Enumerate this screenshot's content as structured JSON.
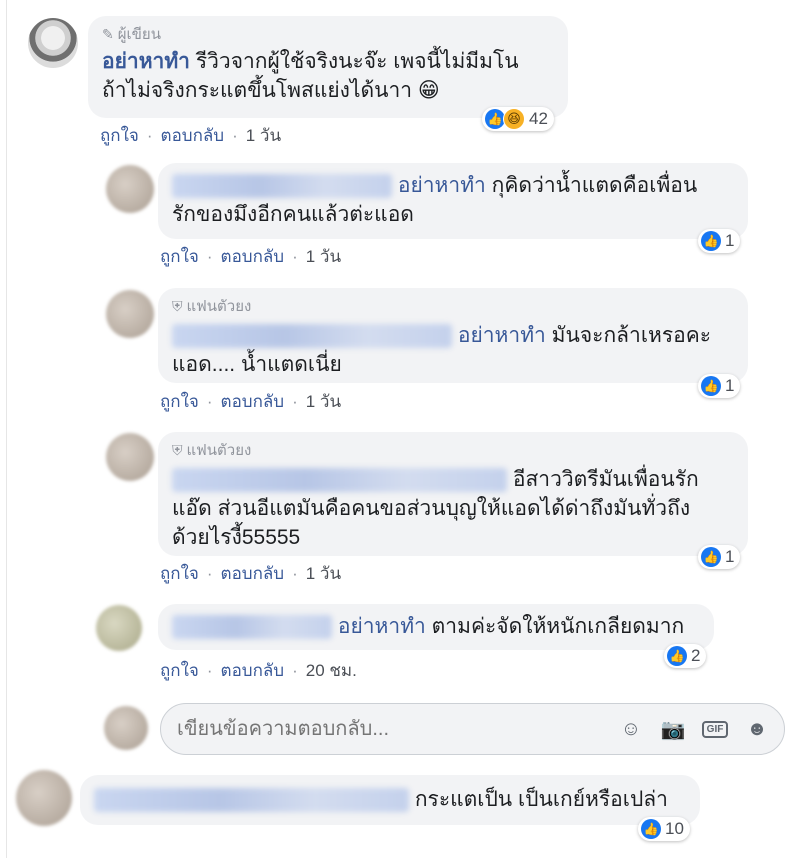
{
  "comments": [
    {
      "badge": "ผู้เขียน",
      "author": "อย่าหาทำ",
      "text_line1": "รีวิวจากผู้ใช้จริงนะจ๊ะ เพจนี้ไม่มีมโน",
      "text_line2": "ถ้าไม่จริงกระแตขึ้นโพสแย่งได้นาา 😁",
      "actions": {
        "like": "ถูกใจ",
        "reply": "ตอบกลับ",
        "time": "1 วัน"
      },
      "reactions": "42"
    },
    {
      "mention": "อย่าหาทำ",
      "text_line1": "กุคิดว่าน้ำแตดคือเพื่อน",
      "text_line2": "รักของมึงอีกคนแล้วต่ะแอด",
      "actions": {
        "like": "ถูกใจ",
        "reply": "ตอบกลับ",
        "time": "1 วัน"
      },
      "reactions": "1"
    },
    {
      "badge": "แฟนตัวยง",
      "mention": "อย่าหาทำ",
      "text_line1": "มันจะกล้าเหรอคะ",
      "text_line2": "แอด.... น้ำแตดเนี่ย",
      "actions": {
        "like": "ถูกใจ",
        "reply": "ตอบกลับ",
        "time": "1 วัน"
      },
      "reactions": "1"
    },
    {
      "badge": "แฟนตัวยง",
      "text_line1": "อีสาววิตรีมันเพื่อนรัก",
      "text_line2": "แอ๊ด ส่วนอีแตมันคือคนขอส่วนบุญให้แอดได้ด่าถึงมันทั่วถึง",
      "text_line3": "ด้วยไรงี้55555",
      "actions": {
        "like": "ถูกใจ",
        "reply": "ตอบกลับ",
        "time": "1 วัน"
      },
      "reactions": "1"
    },
    {
      "mention": "อย่าหาทำ",
      "text_line1": "ตามค่ะจัดให้หนักเกลียดมาก",
      "actions": {
        "like": "ถูกใจ",
        "reply": "ตอบกลับ",
        "time": "20 ชม."
      },
      "reactions": "2"
    },
    {
      "text_line1": "กระแตเป็น เป็นเกย์หรือเปล่า",
      "reactions": "10"
    }
  ],
  "reply_box": {
    "placeholder": "เขียนข้อความตอบกลับ..."
  },
  "icons": {
    "edit": "pencil-icon",
    "fan": "fan-badge-icon",
    "like": "like-icon",
    "haha": "haha-icon",
    "emoji": "emoji-icon",
    "camera": "camera-icon",
    "gif": "gif-icon",
    "sticker": "sticker-icon"
  },
  "gif_label": "GIF",
  "colors": {
    "link": "#385898",
    "like_blue": "#1877f2",
    "bubble": "#f2f3f5"
  }
}
